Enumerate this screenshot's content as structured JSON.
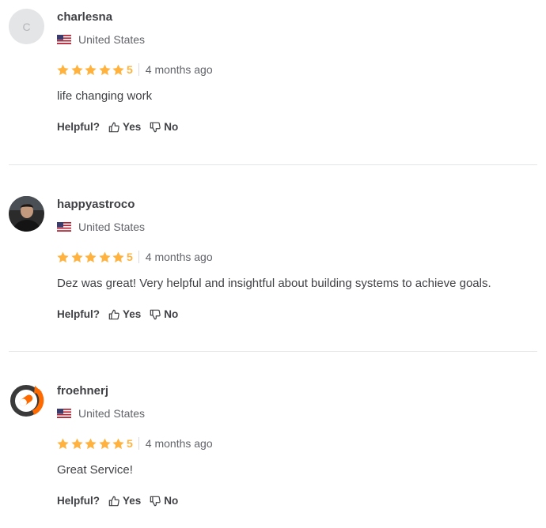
{
  "helpful_label": "Helpful?",
  "yes_label": "Yes",
  "no_label": "No",
  "colors": {
    "star": "#ffb33e",
    "text": "#404145",
    "muted": "#62646a",
    "divider": "#e4e5e7"
  },
  "reviews": [
    {
      "avatar_letter": "C",
      "username": "charlesna",
      "country": "United States",
      "rating": "5",
      "time": "4 months ago",
      "comment": "life changing work"
    },
    {
      "avatar_letter": "",
      "username": "happyastroco",
      "country": "United States",
      "rating": "5",
      "time": "4 months ago",
      "comment": "Dez was great! Very helpful and insightful about building systems to achieve goals."
    },
    {
      "avatar_letter": "",
      "username": "froehnerj",
      "country": "United States",
      "rating": "5",
      "time": "4 months ago",
      "comment": "Great Service!"
    }
  ]
}
